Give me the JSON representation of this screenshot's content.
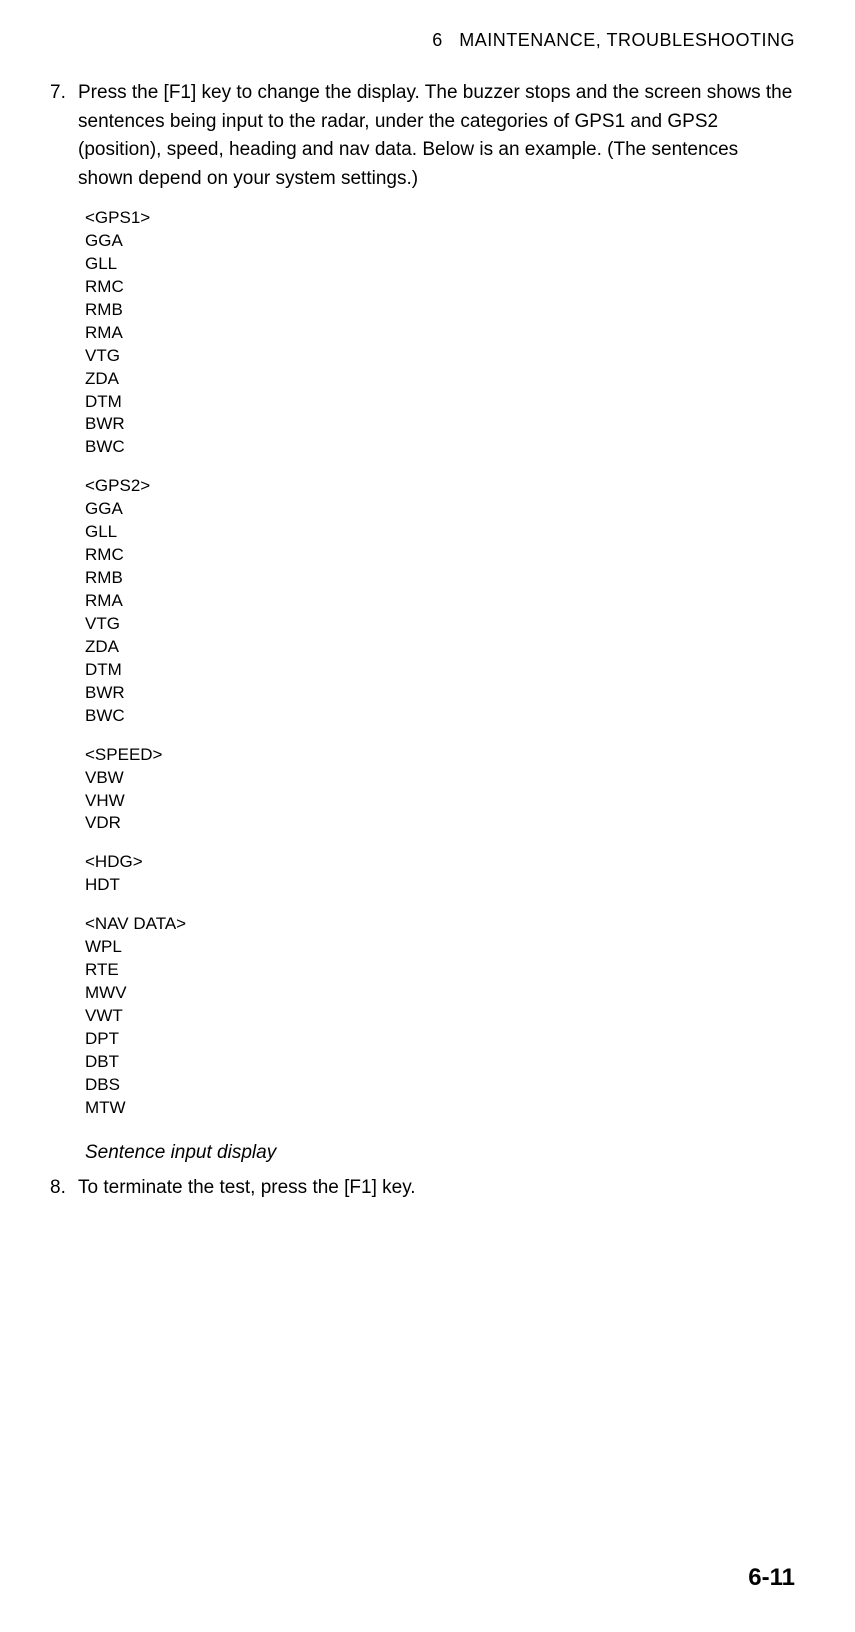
{
  "header": {
    "chapter": "6",
    "title": "MAINTENANCE,  TROUBLESHOOTING"
  },
  "steps": {
    "s7": {
      "num": "7.",
      "text": "Press the [F1] key to change the display. The buzzer stops and the screen shows the sentences being input to the radar, under the categories of GPS1 and GPS2 (position), speed, heading and nav data. Below is an example. (The sentences shown depend on your system settings.)"
    },
    "s8": {
      "num": "8.",
      "text": "To terminate the test, press the [F1] key."
    }
  },
  "code": {
    "groups": [
      {
        "heading": "<GPS1>",
        "lines": [
          "GGA",
          "GLL",
          "RMC",
          "RMB",
          "RMA",
          "VTG",
          "ZDA",
          "DTM",
          "BWR",
          "BWC"
        ]
      },
      {
        "heading": "<GPS2>",
        "lines": [
          "GGA",
          "GLL",
          "RMC",
          "RMB",
          "RMA",
          "VTG",
          "ZDA",
          "DTM",
          "BWR",
          "BWC"
        ]
      },
      {
        "heading": "<SPEED>",
        "lines": [
          "VBW",
          "VHW",
          "VDR"
        ]
      },
      {
        "heading": "<HDG>",
        "lines": [
          "HDT"
        ]
      },
      {
        "heading": "<NAV DATA>",
        "lines": [
          "WPL",
          "RTE",
          "MWV",
          "VWT",
          "DPT",
          "DBT",
          "DBS",
          "MTW"
        ]
      }
    ]
  },
  "caption": "Sentence input display",
  "pageNumber": "6-11"
}
